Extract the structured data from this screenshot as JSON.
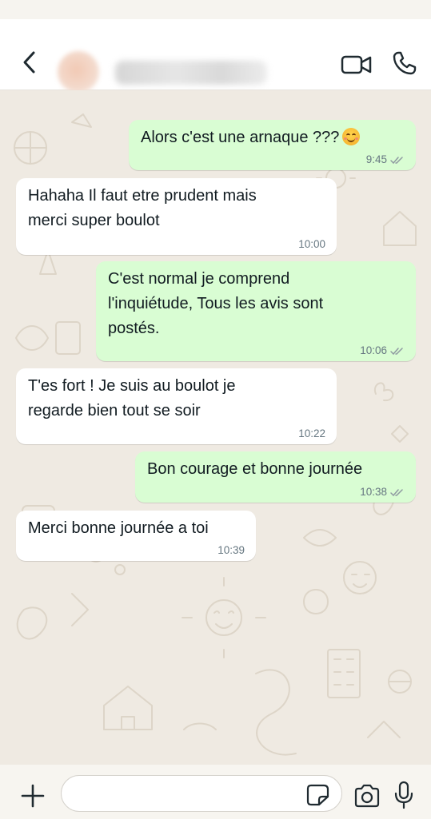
{
  "header": {
    "contact_name": "",
    "back_icon": "chevron-left-icon",
    "video_icon": "video-camera-icon",
    "call_icon": "phone-icon"
  },
  "messages": [
    {
      "direction": "outgoing",
      "text": "Alors c'est une arnaque ???",
      "emoji": "smiling-face-emoji",
      "time": "9:45",
      "status": "read"
    },
    {
      "direction": "incoming",
      "text": "Hahaha Il faut etre prudent mais\nmerci super boulot",
      "time": "10:00"
    },
    {
      "direction": "outgoing",
      "text": "C'est normal je comprend\nl'inquiétude, Tous les avis sont\npostés.",
      "time": "10:06",
      "status": "read"
    },
    {
      "direction": "incoming",
      "text": "T'es fort ! Je suis au boulot je\nregarde bien tout se soir",
      "time": "10:22"
    },
    {
      "direction": "outgoing",
      "text": "Bon courage et bonne journée",
      "time": "10:38",
      "status": "read"
    },
    {
      "direction": "incoming",
      "text": "Merci bonne journée a toi",
      "time": "10:39"
    }
  ],
  "composer": {
    "value": "",
    "placeholder": "",
    "plus_icon": "plus-icon",
    "sticker_icon": "sticker-icon",
    "camera_icon": "camera-icon",
    "mic_icon": "microphone-icon"
  },
  "colors": {
    "outgoing_bubble": "#d9fdd3",
    "incoming_bubble": "#ffffff",
    "chat_background": "#efeae2",
    "timestamp": "#667781",
    "read_ticks": "#8f9aa1"
  }
}
